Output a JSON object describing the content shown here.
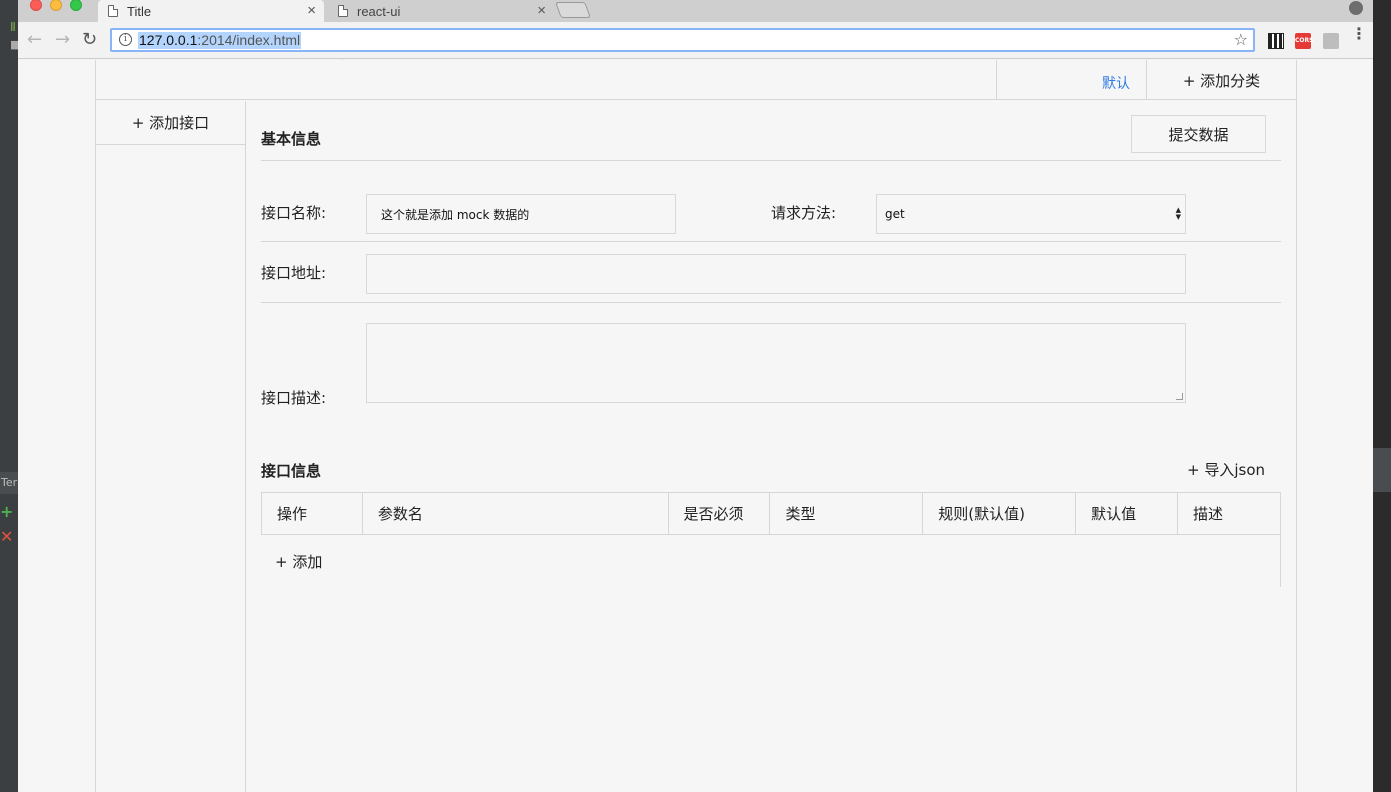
{
  "ide": {
    "tab_label": "Ter"
  },
  "browser": {
    "tabs": [
      {
        "label": "Title",
        "active": true
      },
      {
        "label": "react-ui",
        "active": false
      }
    ],
    "url": {
      "host": "127.0.0.1",
      "rest": ":2014/index.html"
    },
    "extensions": {
      "cors_label": "CORS"
    }
  },
  "topbar": {
    "category_default": "默认",
    "add_category": "+ 添加分类"
  },
  "sidebar": {
    "add_api": "+ 添加接口"
  },
  "basic_info": {
    "title": "基本信息",
    "submit": "提交数据",
    "name_label": "接口名称:",
    "name_value": "这个就是添加 mock 数据的",
    "method_label": "请求方法:",
    "method_value": "get",
    "url_label": "接口地址:",
    "url_value": "",
    "desc_label": "接口描述:",
    "desc_value": ""
  },
  "api_info": {
    "title": "接口信息",
    "import_json": "+ 导入json",
    "columns": [
      "操作",
      "参数名",
      "是否必须",
      "类型",
      "规则(默认值)",
      "默认值",
      "描述"
    ],
    "add_row": "+ 添加"
  },
  "colors": {
    "accent_link": "#2f7ae5",
    "selection": "#b3d4fc"
  }
}
